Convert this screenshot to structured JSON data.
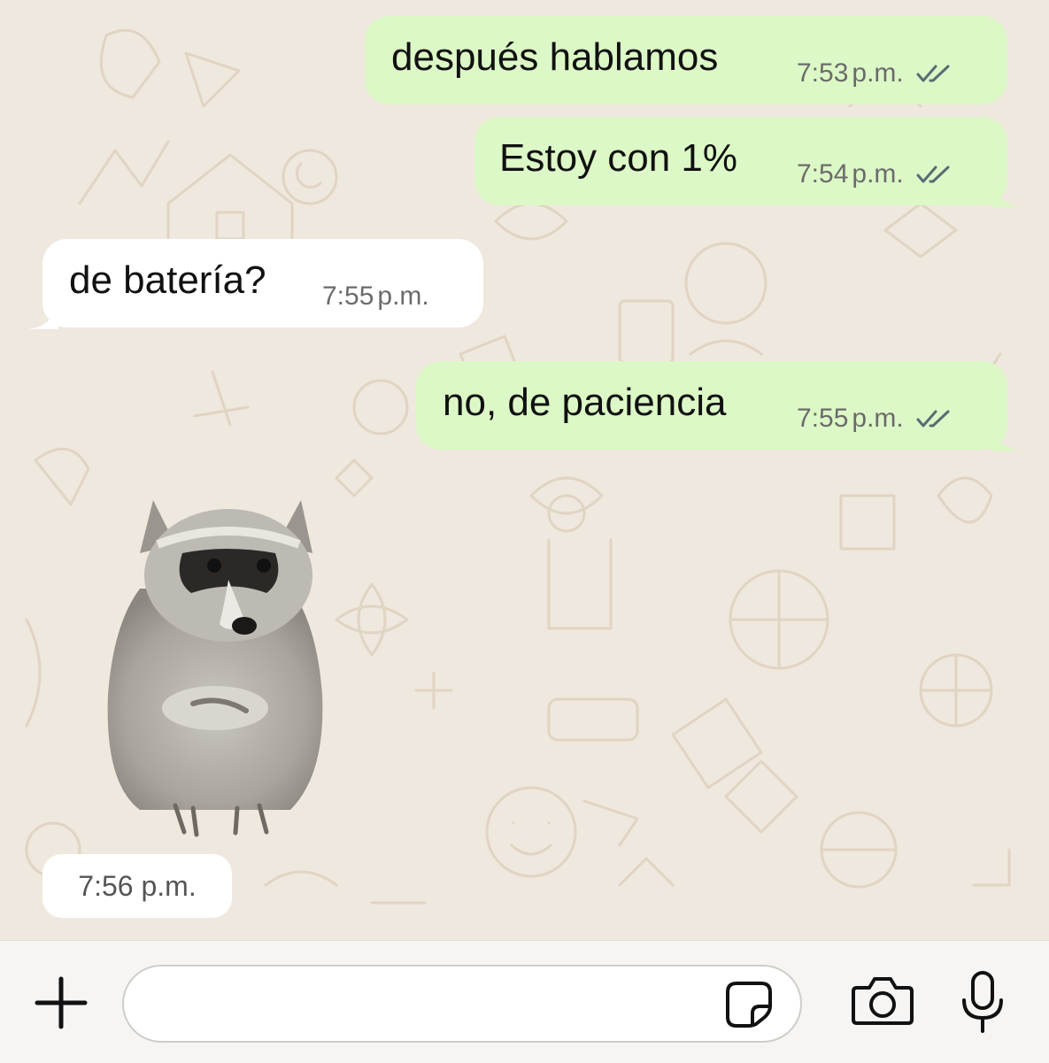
{
  "messages": [
    {
      "id": "m1",
      "direction": "out",
      "text": "después hablamos",
      "time": "7:53",
      "ampm": "p.m.",
      "status": "read-ticks"
    },
    {
      "id": "m2",
      "direction": "out",
      "text": "Estoy con 1%",
      "time": "7:54",
      "ampm": "p.m.",
      "status": "read-ticks"
    },
    {
      "id": "m3",
      "direction": "in",
      "text": "de batería?",
      "time": "7:55",
      "ampm": "p.m."
    },
    {
      "id": "m4",
      "direction": "out",
      "text": "no, de paciencia",
      "time": "7:55",
      "ampm": "p.m.",
      "status": "read-ticks"
    }
  ],
  "sticker": {
    "icon": "raccoon-sticker",
    "time": "7:56 p.m."
  },
  "composer": {
    "input_value": "",
    "icons": [
      "plus-icon",
      "sticker-icon",
      "camera-icon",
      "microphone-icon"
    ]
  },
  "colors": {
    "outgoing": "#dcf8c6",
    "incoming": "#ffffff",
    "wallpaper": "#efe8de",
    "ticks": "#5a6b73"
  }
}
